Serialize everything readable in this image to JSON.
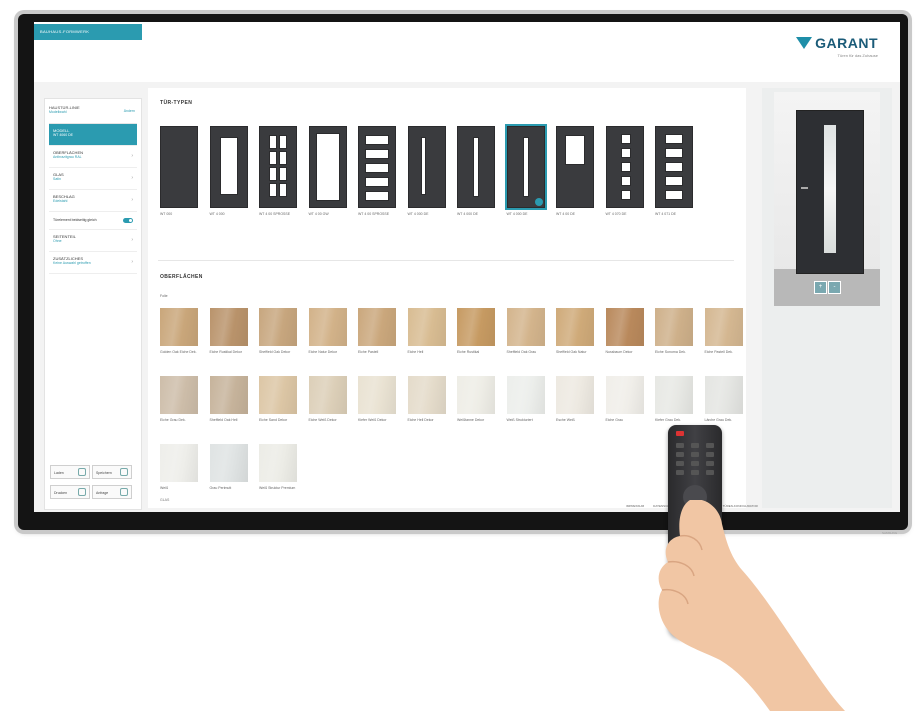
{
  "header": {
    "tab_label": "BAUHAUS-FORMWERK",
    "logo_name": "GARANT",
    "logo_tagline": "Türen für das Zuhause",
    "accent_color": "#2b9bb0",
    "logo_color": "#1a5b78"
  },
  "sidebar": {
    "header_title": "HAUSTÜR-LINIE",
    "header_subtitle": "Modellwahl",
    "edit_label": "Ändern",
    "items": [
      {
        "title": "MODELL",
        "subtitle": "WT 4060 DE",
        "active": true
      },
      {
        "title": "OBERFLÄCHEN",
        "subtitle": "Anthrazitgrau RAL",
        "active": false
      },
      {
        "title": "GLAS",
        "subtitle": "Satin",
        "active": false
      },
      {
        "title": "BESCHLAG",
        "subtitle": "Edelstahl",
        "active": false
      }
    ],
    "toggle_label": "Türelement beidseitig gleich",
    "items2": [
      {
        "title": "SEITENTEIL",
        "subtitle": "Ohne"
      },
      {
        "title": "ZUSÄTZLICHES",
        "subtitle": "Keine Auswahl getroffen"
      }
    ],
    "buttons": [
      {
        "label": "Laden"
      },
      {
        "label": "Speichern"
      },
      {
        "label": "Drucken"
      },
      {
        "label": "Anfrage"
      }
    ]
  },
  "main": {
    "section1_title": "TÜR-TYPEN",
    "doors": [
      {
        "label": "WT 000",
        "type": "plain"
      },
      {
        "label": "WT 4 000",
        "type": "tall-window"
      },
      {
        "label": "WT 4 00 SPROSSE",
        "type": "grid"
      },
      {
        "label": "WT 4 00 GW",
        "type": "frame"
      },
      {
        "label": "WT 4 00 SPROSSE",
        "type": "horizontal-bars"
      },
      {
        "label": "WT 4 000 DE",
        "type": "narrow-slot"
      },
      {
        "label": "WT 4 000 DE",
        "type": "center-slot"
      },
      {
        "label": "WT 4 000 DE",
        "type": "center-slot",
        "selected": true
      },
      {
        "label": "WT 4 00 DE",
        "type": "top-window"
      },
      {
        "label": "WT 4 070 DE",
        "type": "squares"
      },
      {
        "label": "WT 4 071 DE",
        "type": "wide-bars"
      }
    ],
    "section2_title": "OBERFLÄCHEN",
    "subsection_label": "Folie",
    "swatches": [
      {
        "label": "Golden Oak Eiche Dek.",
        "color": "#c9a67a"
      },
      {
        "label": "Eiche Rustikal Dekor",
        "color": "#b9936b"
      },
      {
        "label": "Sheffield Oak Dekor",
        "color": "#c7a67e"
      },
      {
        "label": "Eiche Natur Dekor",
        "color": "#d2b289"
      },
      {
        "label": "Eiche Pastell",
        "color": "#caa77c"
      },
      {
        "label": "Eiche Hell",
        "color": "#d8bc92"
      },
      {
        "label": "Eiche Rustikal",
        "color": "#c69a62"
      },
      {
        "label": "Sheffield Oak Grau",
        "color": "#d3b48c"
      },
      {
        "label": "Sheffield Oak Natur",
        "color": "#cfaa79"
      },
      {
        "label": "Nussbaum Dekor",
        "color": "#b9895c"
      },
      {
        "label": "Eiche Sonoma Dek.",
        "color": "#ceb08a"
      },
      {
        "label": "Eiche Pastell Dek.",
        "color": "#d4b791"
      },
      {
        "label": "Eiche Grau Dek.",
        "color": "#cdbda9"
      },
      {
        "label": "Sheffield Oak Hell",
        "color": "#c6b39b"
      },
      {
        "label": "Eiche Sand Dekor",
        "color": "#dcc6a5"
      },
      {
        "label": "Eiche Weiß Dekor",
        "color": "#dccfb8"
      },
      {
        "label": "Kiefer Weiß Dekor",
        "color": "#e9e2d2"
      },
      {
        "label": "Eiche Hell Dekor",
        "color": "#e4dbca"
      },
      {
        "label": "Weißtanne Dekor",
        "color": "#eeede6"
      },
      {
        "label": "Weiß Strukturiert",
        "color": "#eceeeb"
      },
      {
        "label": "Esche Weiß",
        "color": "#ede9e1"
      },
      {
        "label": "Eiche Grau",
        "color": "#f0eee9"
      },
      {
        "label": "Kiefer Grau Dek.",
        "color": "#e7e8e4"
      },
      {
        "label": "Lärche Grau Dek.",
        "color": "#e4e5e2"
      },
      {
        "label": "Weiß",
        "color": "#eeeeea"
      },
      {
        "label": "Grau Perlmutt",
        "color": "#dfe3e3"
      },
      {
        "label": "Weiß Struktur Premium",
        "color": "#ecece6"
      }
    ],
    "bottom_label": "GLAS"
  },
  "footer": {
    "links": [
      "IMPRESSUM",
      "DATENSCHUTZ",
      "AGB",
      "KONTAKT",
      "TÜREN-KONFIGURATOR"
    ]
  },
  "preview": {
    "zoom_in_label": "+",
    "zoom_out_label": "-"
  },
  "tv_brand": "SAMSUNG"
}
